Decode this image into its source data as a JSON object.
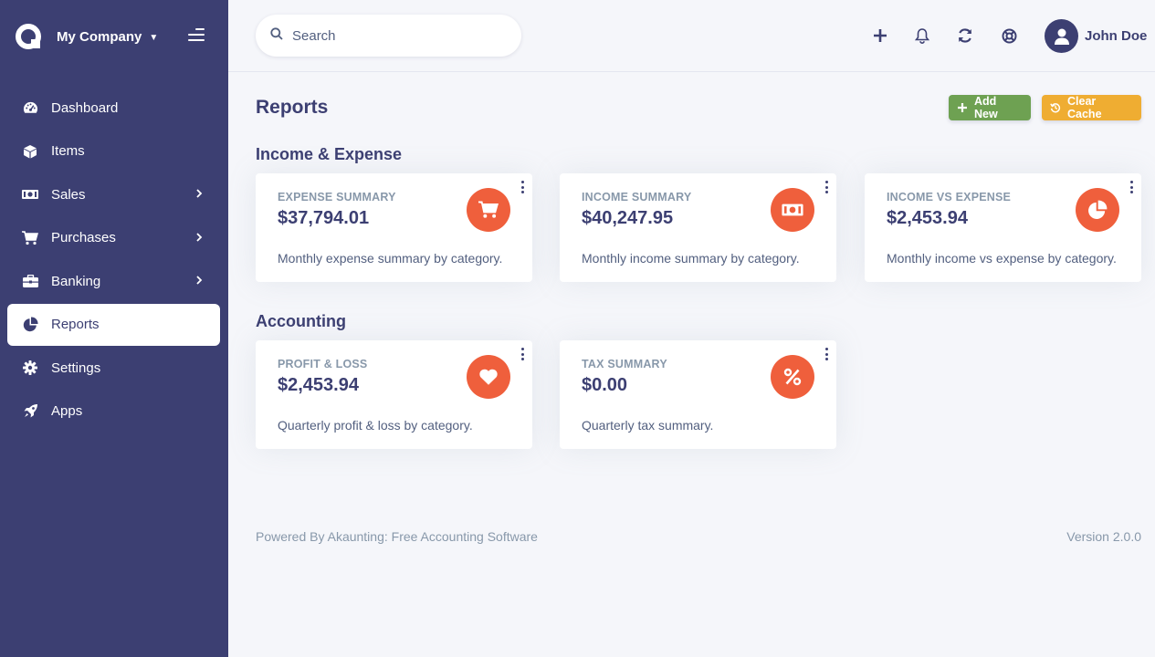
{
  "sidebar": {
    "company": "My Company",
    "items": [
      {
        "label": "Dashboard",
        "icon": "tachometer-icon"
      },
      {
        "label": "Items",
        "icon": "cube-icon"
      },
      {
        "label": "Sales",
        "icon": "money-icon",
        "has_submenu": true
      },
      {
        "label": "Purchases",
        "icon": "shopping-cart-icon",
        "has_submenu": true
      },
      {
        "label": "Banking",
        "icon": "briefcase-icon",
        "has_submenu": true
      },
      {
        "label": "Reports",
        "icon": "pie-chart-icon",
        "active": true
      },
      {
        "label": "Settings",
        "icon": "gear-icon"
      },
      {
        "label": "Apps",
        "icon": "rocket-icon"
      }
    ]
  },
  "topbar": {
    "search_placeholder": "Search",
    "user_name": "John Doe"
  },
  "page": {
    "title": "Reports",
    "add_new_label": "Add New",
    "clear_cache_label": "Clear Cache"
  },
  "sections": [
    {
      "title": "Income & Expense",
      "cards": [
        {
          "title": "Expense Summary",
          "amount": "$37,794.01",
          "description": "Monthly expense summary by category.",
          "icon": "shopping-cart-icon"
        },
        {
          "title": "Income Summary",
          "amount": "$40,247.95",
          "description": "Monthly income summary by category.",
          "icon": "money-bill-icon"
        },
        {
          "title": "Income vs Expense",
          "amount": "$2,453.94",
          "description": "Monthly income vs expense by category.",
          "icon": "pie-chart-icon"
        }
      ]
    },
    {
      "title": "Accounting",
      "cards": [
        {
          "title": "Profit & Loss",
          "amount": "$2,453.94",
          "description": "Quarterly profit & loss by category.",
          "icon": "heart-icon"
        },
        {
          "title": "Tax Summary",
          "amount": "$0.00",
          "description": "Quarterly tax summary.",
          "icon": "percent-icon"
        }
      ]
    }
  ],
  "footer": {
    "powered_by": "Powered By Akaunting: Free Accounting Software",
    "version": "Version 2.0.0"
  },
  "colors": {
    "sidebar": "#3c3f72",
    "accent": "#ef5f3c",
    "add_button": "#6ea152",
    "clear_button": "#efad32"
  }
}
